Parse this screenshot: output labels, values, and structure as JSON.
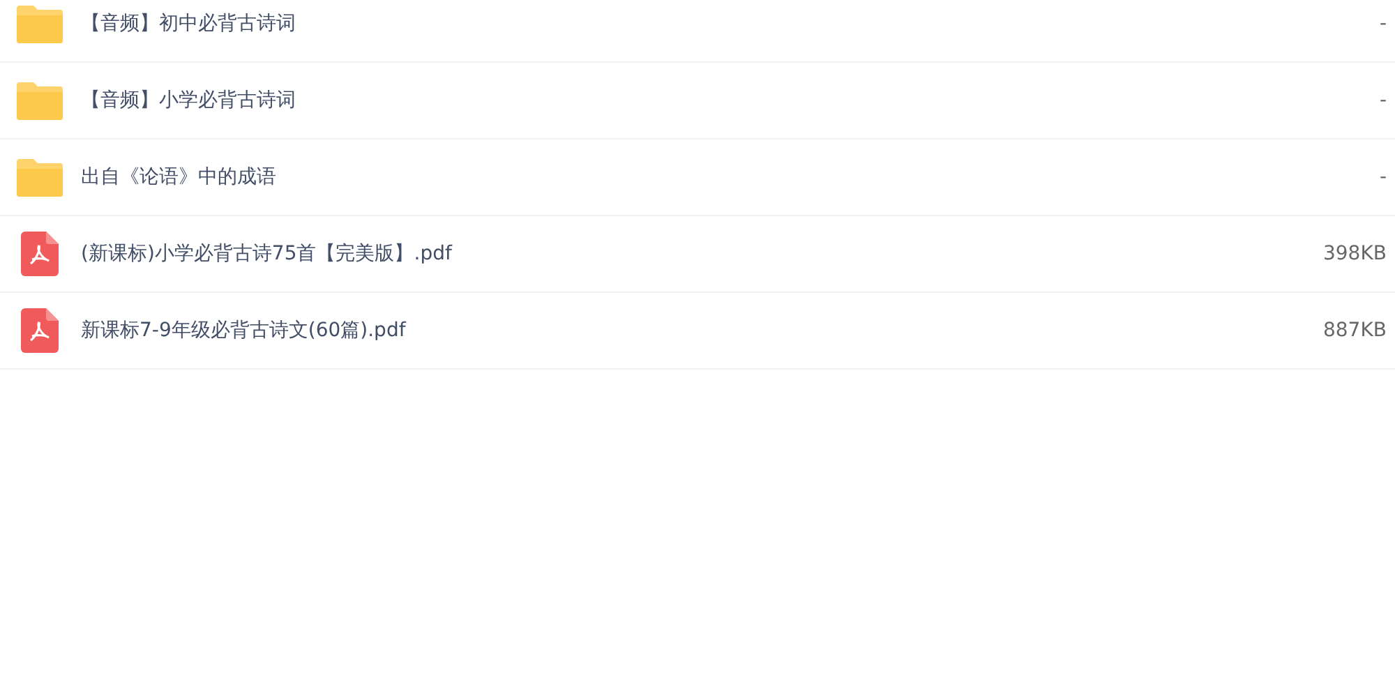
{
  "files": [
    {
      "kind": "folder",
      "name": "【音频】初中必背古诗词",
      "size": "-"
    },
    {
      "kind": "folder",
      "name": "【音频】小学必背古诗词",
      "size": "-"
    },
    {
      "kind": "folder",
      "name": "出自《论语》中的成语",
      "size": "-"
    },
    {
      "kind": "pdf",
      "name": "(新课标)小学必背古诗75首【完美版】.pdf",
      "size": "398KB"
    },
    {
      "kind": "pdf",
      "name": "新课标7-9年级必背古诗文(60篇).pdf",
      "size": "887KB"
    }
  ]
}
